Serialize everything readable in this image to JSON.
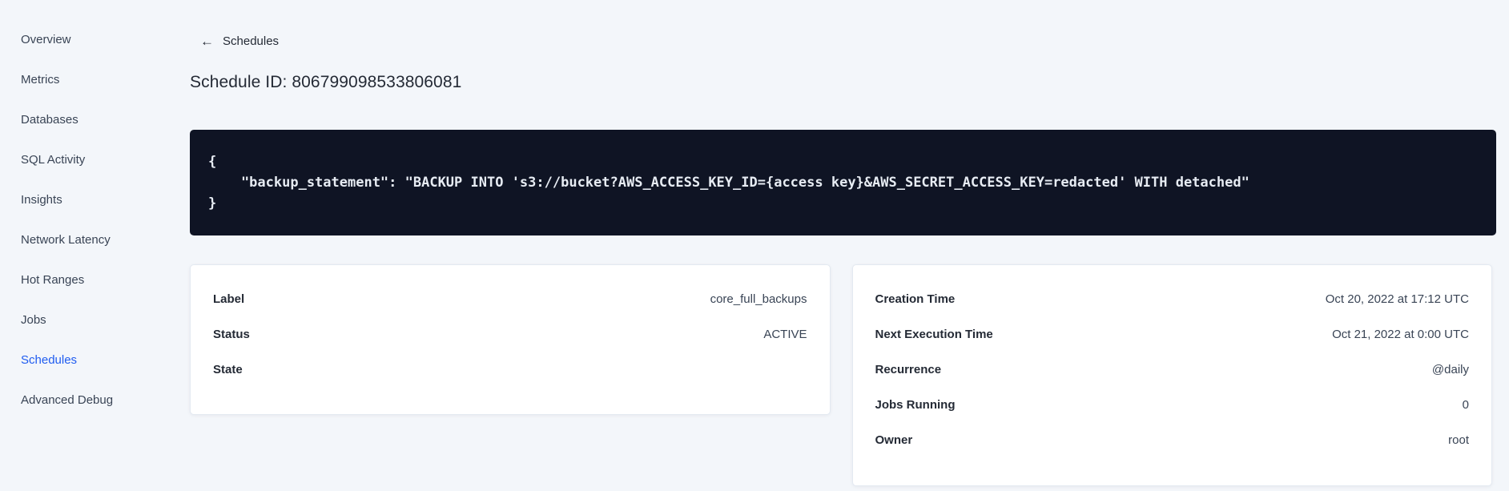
{
  "colors": {
    "page_background": "#f3f6fa",
    "accent_blue": "#1f5cf0",
    "code_block_background": "#0f1424",
    "code_text": "#e7ecf3",
    "heading_text": "#242a35",
    "body_text": "#394455"
  },
  "icons": {
    "back_arrow": "←"
  },
  "sidebar": {
    "items": [
      {
        "label": "Overview",
        "active": false
      },
      {
        "label": "Metrics",
        "active": false
      },
      {
        "label": "Databases",
        "active": false
      },
      {
        "label": "SQL Activity",
        "active": false
      },
      {
        "label": "Insights",
        "active": false
      },
      {
        "label": "Network Latency",
        "active": false
      },
      {
        "label": "Hot Ranges",
        "active": false
      },
      {
        "label": "Jobs",
        "active": false
      },
      {
        "label": "Schedules",
        "active": true
      },
      {
        "label": "Advanced Debug",
        "active": false
      }
    ]
  },
  "header": {
    "back_label": "Schedules",
    "title": "Schedule ID: 806799098533806081"
  },
  "code_block": {
    "text": "{\n    \"backup_statement\": \"BACKUP INTO 's3://bucket?AWS_ACCESS_KEY_ID={access key}&AWS_SECRET_ACCESS_KEY=redacted' WITH detached\"\n}"
  },
  "cards": {
    "left": {
      "rows": [
        {
          "label": "Label",
          "value": "core_full_backups"
        },
        {
          "label": "Status",
          "value": "ACTIVE"
        },
        {
          "label": "State",
          "value": ""
        }
      ]
    },
    "right": {
      "rows": [
        {
          "label": "Creation Time",
          "value": "Oct 20, 2022 at 17:12 UTC"
        },
        {
          "label": "Next Execution Time",
          "value": "Oct 21, 2022 at 0:00 UTC"
        },
        {
          "label": "Recurrence",
          "value": "@daily"
        },
        {
          "label": "Jobs Running",
          "value": "0"
        },
        {
          "label": "Owner",
          "value": "root"
        }
      ]
    }
  }
}
